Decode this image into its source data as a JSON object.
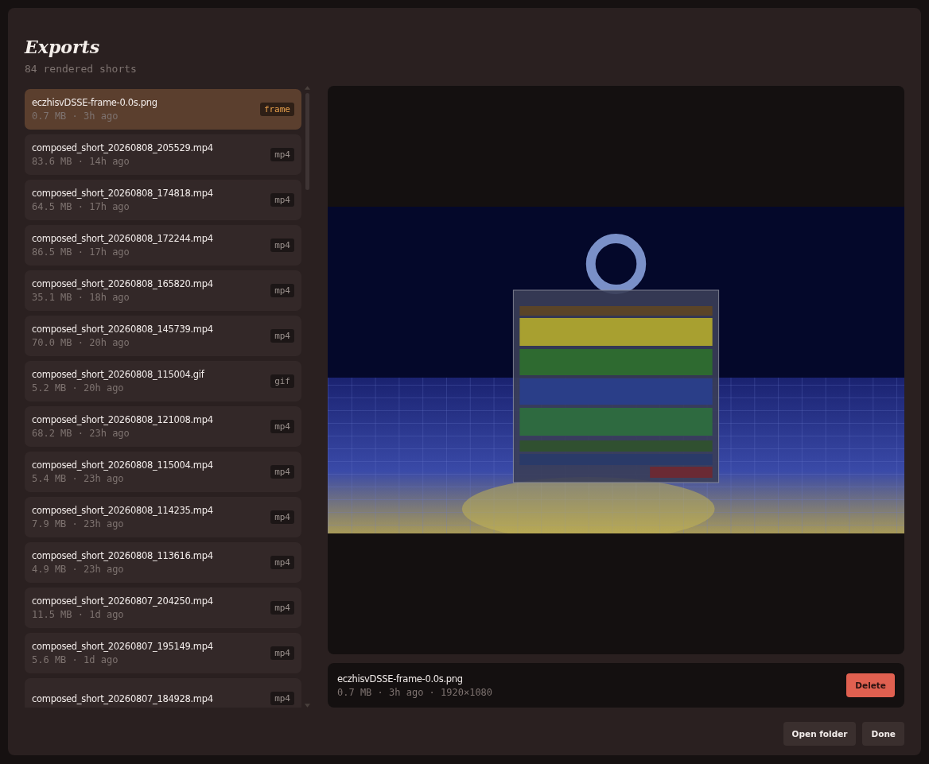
{
  "title": "Exports",
  "subtitle": "84 rendered shorts",
  "files": [
    {
      "name": "eczhisvDSSE-frame-0.0s.png",
      "meta": "0.7 MB · 3h ago",
      "kind": "frame",
      "tag": "frame",
      "selected": true
    },
    {
      "name": "composed_short_20260808_205529.mp4",
      "meta": "83.6 MB · 14h ago",
      "kind": "video",
      "tag": "mp4",
      "selected": false
    },
    {
      "name": "composed_short_20260808_174818.mp4",
      "meta": "64.5 MB · 17h ago",
      "kind": "video",
      "tag": "mp4",
      "selected": false
    },
    {
      "name": "composed_short_20260808_172244.mp4",
      "meta": "86.5 MB · 17h ago",
      "kind": "video",
      "tag": "mp4",
      "selected": false
    },
    {
      "name": "composed_short_20260808_165820.mp4",
      "meta": "35.1 MB · 18h ago",
      "kind": "video",
      "tag": "mp4",
      "selected": false
    },
    {
      "name": "composed_short_20260808_145739.mp4",
      "meta": "70.0 MB · 20h ago",
      "kind": "video",
      "tag": "mp4",
      "selected": false
    },
    {
      "name": "composed_short_20260808_115004.gif",
      "meta": "5.2 MB · 20h ago",
      "kind": "video",
      "tag": "gif",
      "selected": false
    },
    {
      "name": "composed_short_20260808_121008.mp4",
      "meta": "68.2 MB · 23h ago",
      "kind": "video",
      "tag": "mp4",
      "selected": false
    },
    {
      "name": "composed_short_20260808_115004.mp4",
      "meta": "5.4 MB · 23h ago",
      "kind": "video",
      "tag": "mp4",
      "selected": false
    },
    {
      "name": "composed_short_20260808_114235.mp4",
      "meta": "7.9 MB · 23h ago",
      "kind": "video",
      "tag": "mp4",
      "selected": false
    },
    {
      "name": "composed_short_20260808_113616.mp4",
      "meta": "4.9 MB · 23h ago",
      "kind": "video",
      "tag": "mp4",
      "selected": false
    },
    {
      "name": "composed_short_20260807_204250.mp4",
      "meta": "11.5 MB · 1d ago",
      "kind": "video",
      "tag": "mp4",
      "selected": false
    },
    {
      "name": "composed_short_20260807_195149.mp4",
      "meta": "5.6 MB · 1d ago",
      "kind": "video",
      "tag": "mp4",
      "selected": false
    },
    {
      "name": "composed_short_20260807_184928.mp4",
      "kind": "video",
      "tag": "mp4",
      "selected": false
    }
  ],
  "details": {
    "name": "eczhisvDSSE-frame-0.0s.png",
    "meta": "0.7 MB · 3h ago · 1920×1080",
    "delete": "Delete"
  },
  "buttons": [
    "Open folder",
    "Done"
  ]
}
